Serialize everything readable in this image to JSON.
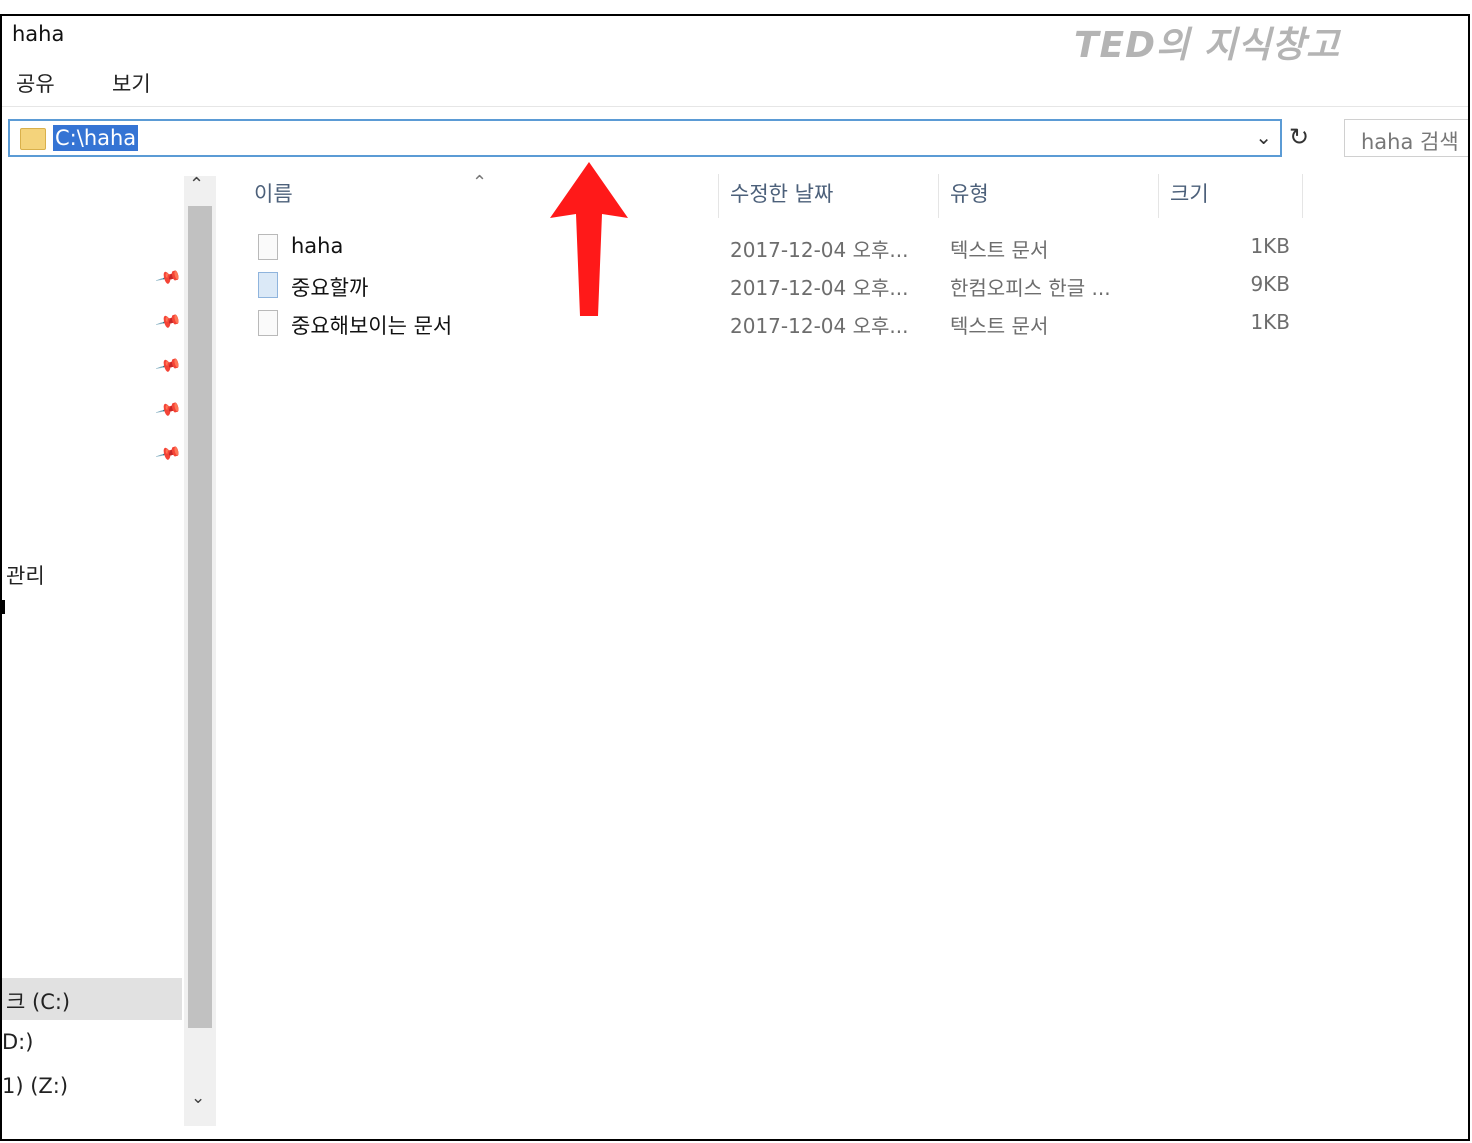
{
  "window": {
    "title": "haha",
    "watermark": "TED의 지식창고"
  },
  "ribbon": {
    "tabs": [
      "공유",
      "보기"
    ]
  },
  "address_bar": {
    "path": "C:\\haha",
    "search_placeholder": "haha 검색"
  },
  "nav_pane": {
    "visible_labels": {
      "manage": "관리",
      "drive_c": "크 (C:)",
      "drive_d": "D:)",
      "drive_z": "1) (Z:)"
    }
  },
  "columns": {
    "name": "이름",
    "date": "수정한 날짜",
    "type": "유형",
    "size": "크기"
  },
  "files": [
    {
      "name": "haha",
      "date": "2017-12-04 오후...",
      "type": "텍스트 문서",
      "size": "1KB",
      "icon": "text-file-icon"
    },
    {
      "name": "중요할까",
      "date": "2017-12-04 오후...",
      "type": "한컴오피스 한글 ...",
      "size": "9KB",
      "icon": "hwp-file-icon"
    },
    {
      "name": "중요해보이는 문서",
      "date": "2017-12-04 오후...",
      "type": "텍스트 문서",
      "size": "1KB",
      "icon": "text-file-icon"
    }
  ],
  "colors": {
    "address_border": "#5b9bd5",
    "selection": "#3574d4",
    "annotation_arrow": "#ff0000"
  }
}
